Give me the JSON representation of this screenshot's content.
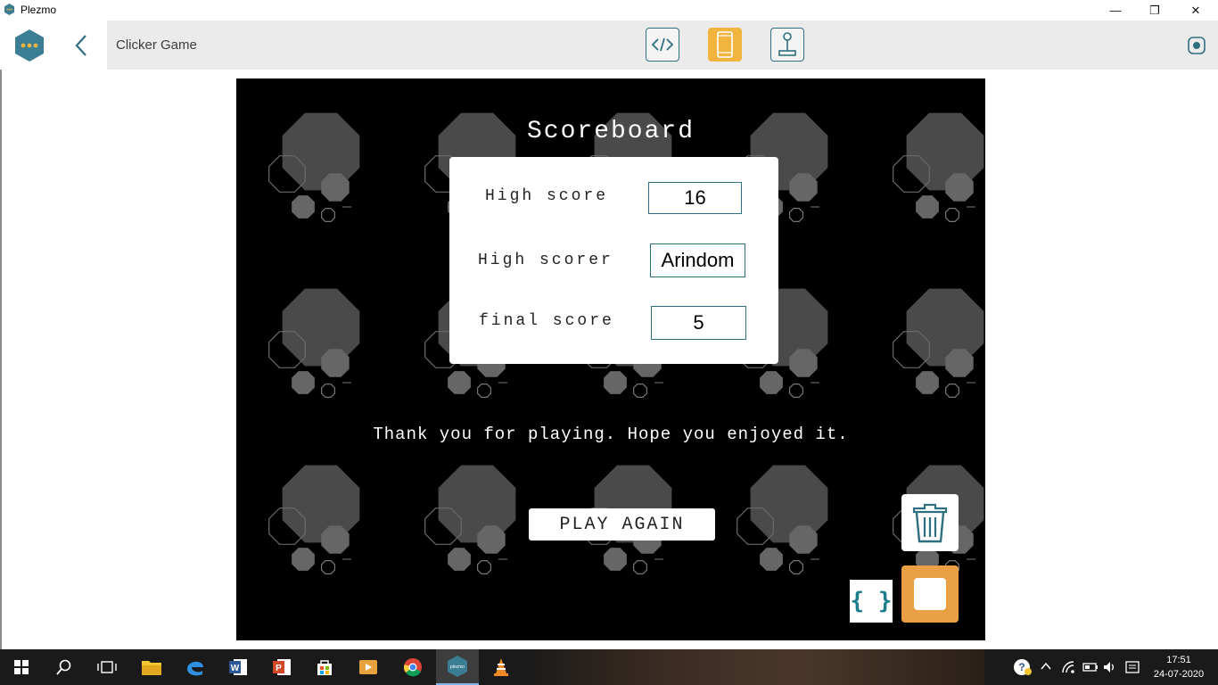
{
  "window": {
    "title": "Plezmo",
    "controls": {
      "minimize": "—",
      "maximize": "❐",
      "close": "✕"
    }
  },
  "header": {
    "page_title": "Clicker Game",
    "modes": [
      {
        "name": "code",
        "icon": "code-icon",
        "active": false
      },
      {
        "name": "device",
        "icon": "phone-icon",
        "active": true
      },
      {
        "name": "controller",
        "icon": "joystick-icon",
        "active": false
      }
    ]
  },
  "stage": {
    "title": "Scoreboard",
    "scoreboard": {
      "rows": [
        {
          "label": "High score",
          "value": "16"
        },
        {
          "label": "High scorer",
          "value": "Arindom"
        },
        {
          "label": "final score",
          "value": "5"
        }
      ]
    },
    "message": "Thank you for playing. Hope you enjoyed it.",
    "play_again_label": "PLAY AGAIN",
    "code_button_label": "{ }"
  },
  "taskbar": {
    "apps": [
      "windows-start",
      "search",
      "task-view",
      "file-explorer",
      "edge",
      "word",
      "powerpoint",
      "store",
      "media-player",
      "chrome",
      "plezmo",
      "vlc"
    ],
    "active_app": "plezmo",
    "plezmo_label": "plezmo",
    "time": "17:51",
    "date": "24-07-2020"
  },
  "colors": {
    "accent": "#2e6f80",
    "active_mode": "#f0b43f",
    "stop": "#e9a044",
    "stage_bg": "#000000"
  }
}
